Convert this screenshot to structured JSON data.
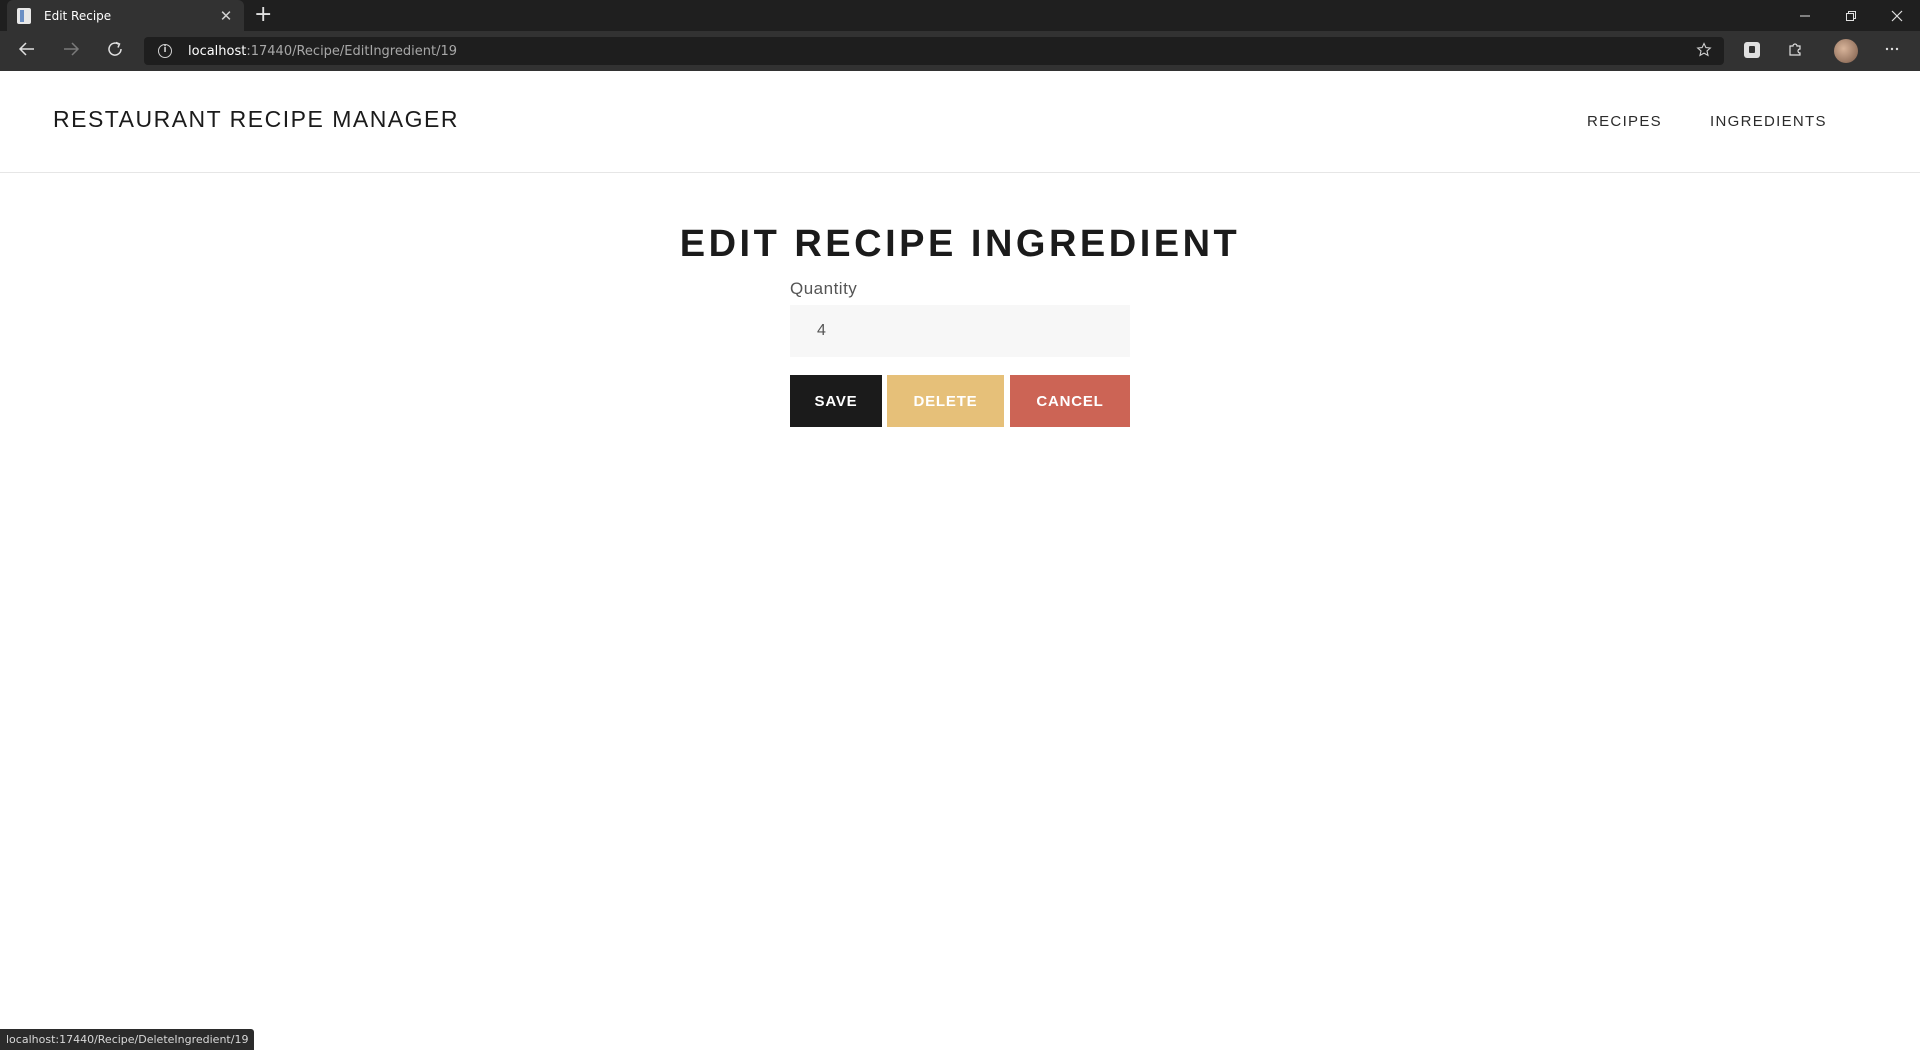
{
  "browser": {
    "tab_title": "Edit Recipe",
    "tab_close": "✕",
    "new_tab": "+",
    "url_host": "localhost",
    "url_path": ":17440/Recipe/EditIngredient/19",
    "status_url": "localhost:17440/Recipe/DeleteIngredient/19",
    "icons": [
      "page-favicon-icon",
      "close-icon",
      "plus-icon",
      "back-arrow-icon",
      "forward-arrow-icon",
      "reload-icon",
      "info-icon",
      "favorites-star-icon",
      "password-lock-icon",
      "extensions-icon",
      "avatar",
      "more-icon",
      "minimize-icon",
      "restore-icon",
      "window-close-icon"
    ]
  },
  "header": {
    "brand": "RESTAURANT RECIPE MANAGER",
    "nav": [
      {
        "label": "RECIPES"
      },
      {
        "label": "INGREDIENTS"
      }
    ]
  },
  "main": {
    "title": "EDIT RECIPE INGREDIENT",
    "quantity_label": "Quantity",
    "quantity_value": "4",
    "save_label": "SAVE",
    "delete_label": "DELETE",
    "cancel_label": "CANCEL"
  },
  "colors": {
    "save": "#1b1b1b",
    "delete": "#e6c079",
    "cancel": "#cc6455",
    "input_bg": "#f7f7f7"
  }
}
